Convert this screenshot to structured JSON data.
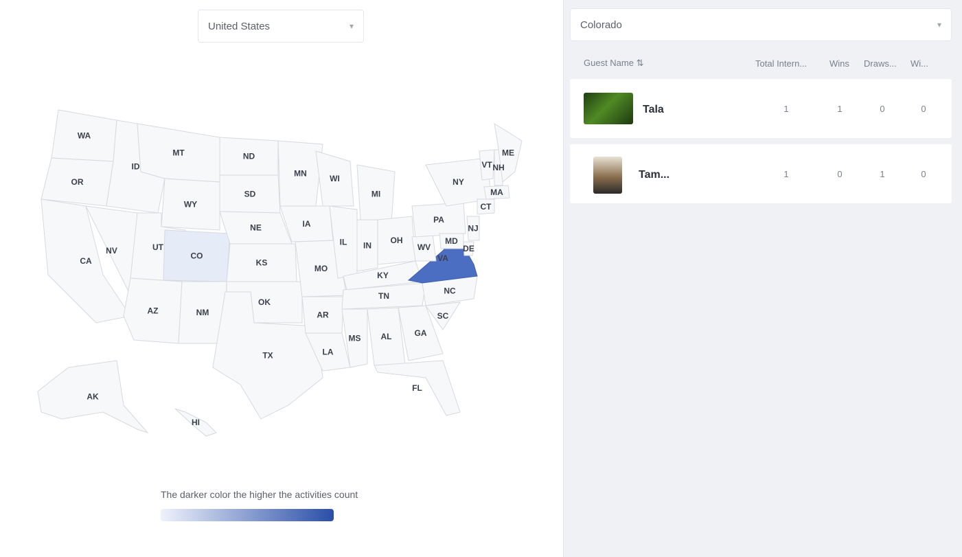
{
  "country_select": {
    "value": "United States"
  },
  "state_select": {
    "value": "Colorado"
  },
  "table": {
    "columns": [
      "Guest Name",
      "Total Intern...",
      "Wins",
      "Draws...",
      "Wi..."
    ],
    "rows": [
      {
        "name": "Tala",
        "values": [
          "1",
          "1",
          "0",
          "0"
        ]
      },
      {
        "name": "Tam...",
        "values": [
          "1",
          "0",
          "1",
          "0"
        ]
      }
    ]
  },
  "legend": {
    "text": "The darker color the higher the activities count"
  },
  "colors": {
    "selected_state": "#e6ecf7",
    "highlight_state": "#4c6ec2",
    "panel_bg": "#eff1f4"
  },
  "map_labels": [
    "WA",
    "OR",
    "CA",
    "ID",
    "NV",
    "MT",
    "WY",
    "UT",
    "AZ",
    "CO",
    "NM",
    "ND",
    "SD",
    "NE",
    "KS",
    "OK",
    "TX",
    "MN",
    "IA",
    "MO",
    "AR",
    "LA",
    "WI",
    "IL",
    "MI",
    "IN",
    "OH",
    "KY",
    "TN",
    "MS",
    "AL",
    "GA",
    "FL",
    "SC",
    "NC",
    "VA",
    "WV",
    "PA",
    "NY",
    "ME",
    "VT",
    "NH",
    "MA",
    "CT",
    "NJ",
    "DE",
    "MD",
    "AK",
    "HI"
  ]
}
